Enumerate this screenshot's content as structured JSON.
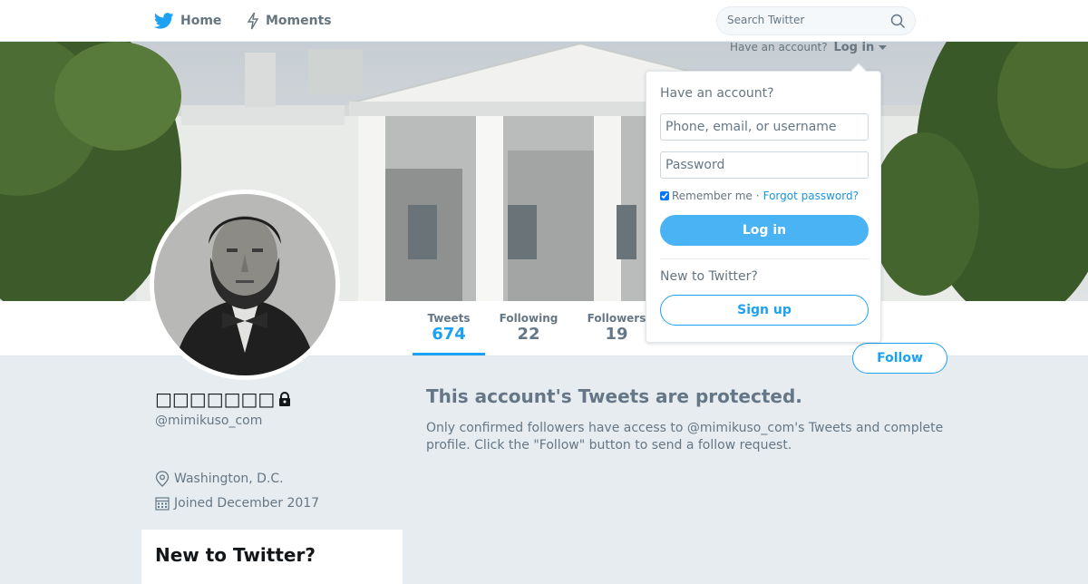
{
  "colors": {
    "accent": "#1da1f2",
    "accent_button": "#4ab3f4",
    "muted": "#657786",
    "page_bg": "#e6ecf0"
  },
  "header": {
    "home_label": "Home",
    "moments_label": "Moments",
    "search_placeholder": "Search Twitter",
    "icons": [
      "twitter-bird-icon",
      "lightning-icon",
      "search-icon"
    ]
  },
  "account_prompt": {
    "text": "Have an account?",
    "login_label": "Log in"
  },
  "login_dropdown": {
    "heading": "Have an account?",
    "username_placeholder": "Phone, email, or username",
    "password_placeholder": "Password",
    "remember_label": "Remember me",
    "separator": "·",
    "forgot_label": "Forgot password?",
    "login_button": "Log in",
    "new_prompt": "New to Twitter?",
    "signup_button": "Sign up"
  },
  "stats": [
    {
      "label": "Tweets",
      "value": "674"
    },
    {
      "label": "Following",
      "value": "22"
    },
    {
      "label": "Followers",
      "value": "19"
    }
  ],
  "profile": {
    "name": "□□□□□□□",
    "handle": "@mimikuso_com",
    "location": "Washington, D.C.",
    "joined": "Joined December 2017",
    "follow_button": "Follow"
  },
  "protected": {
    "title": "This account's Tweets are protected.",
    "body": "Only confirmed followers have access to @mimikuso_com's Tweets and complete profile. Click the \"Follow\" button to send a follow request."
  },
  "new_card": {
    "title": "New to Twitter?"
  }
}
